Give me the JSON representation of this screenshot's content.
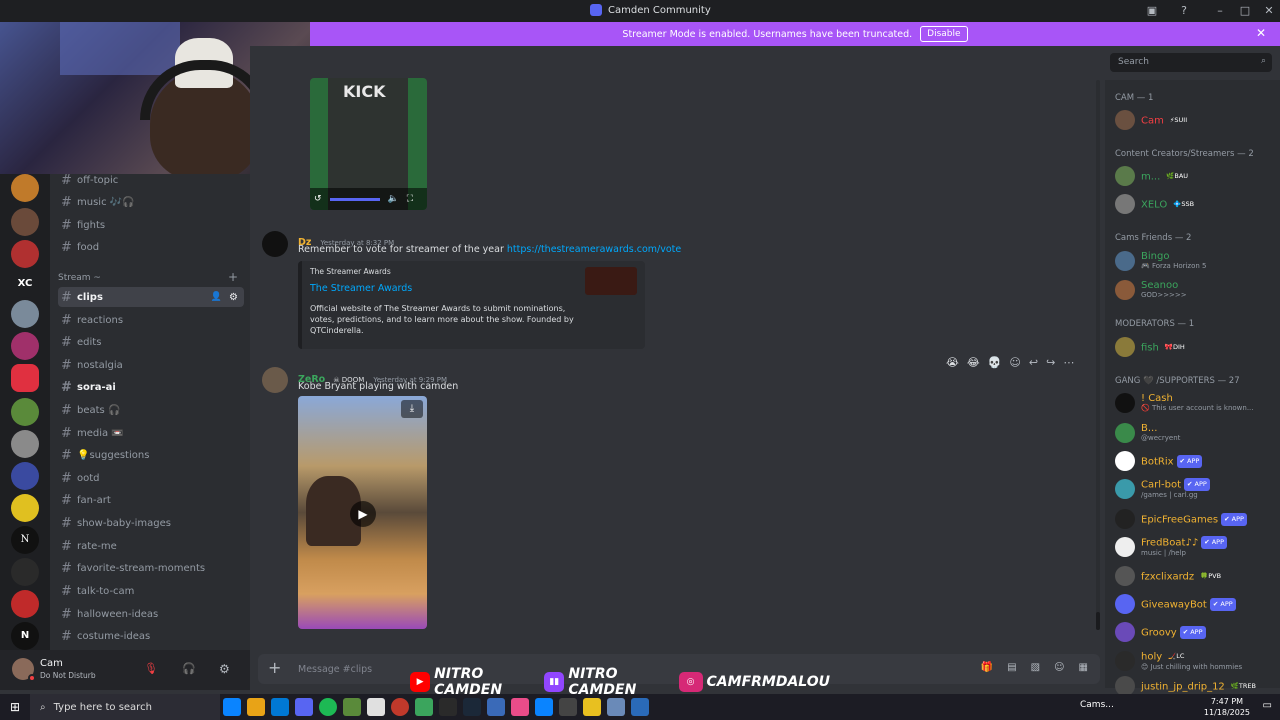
{
  "window": {
    "title": "Camden Community"
  },
  "banner": {
    "text": "Streamer Mode is enabled. Usernames have been truncated.",
    "button": "Disable"
  },
  "header": {
    "search_placeholder": "Search"
  },
  "channels": [
    {
      "label": "off-topic"
    },
    {
      "label": "music 🎶🎧"
    },
    {
      "label": "fights"
    },
    {
      "label": "food"
    }
  ],
  "stream_category": "Stream ~",
  "stream_channels": [
    {
      "label": "clips",
      "active": true
    },
    {
      "label": "reactions"
    },
    {
      "label": "edits"
    },
    {
      "label": "nostalgia"
    },
    {
      "label": "sora-ai"
    },
    {
      "label": "beats 🎧"
    },
    {
      "label": "media 📼"
    },
    {
      "label": "💡suggestions"
    },
    {
      "label": "ootd"
    },
    {
      "label": "fan-art"
    },
    {
      "label": "show-baby-images"
    },
    {
      "label": "rate-me"
    },
    {
      "label": "favorite-stream-moments"
    },
    {
      "label": "talk-to-cam"
    },
    {
      "label": "halloween-ideas"
    },
    {
      "label": "costume-ideas"
    }
  ],
  "user": {
    "name": "Cam",
    "status": "Do Not Disturb"
  },
  "messages": {
    "m1": {
      "author": "Dz",
      "timestamp": "Yesterday at 8:32 PM",
      "text": "Remember to vote for streamer of the year ",
      "link": "https://thestreamerawards.com/vote",
      "embed": {
        "site": "The Streamer Awards",
        "title": "The Streamer Awards",
        "desc": "Official website of The Streamer Awards to submit nominations, votes, predictions, and to learn more about the show. Founded by QTCinderella."
      }
    },
    "m2": {
      "author": "ZeRo",
      "badge": "DOOM",
      "timestamp": "Yesterday at 9:29 PM",
      "text": "Kobe Bryant playing with camden"
    },
    "video_top": {
      "label": "KICK"
    }
  },
  "composer": {
    "placeholder": "Message #clips"
  },
  "members": {
    "sections": [
      {
        "title": "CAM — 1"
      },
      {
        "title": "Content Creators/Streamers — 2"
      },
      {
        "title": "Cams Friends — 2"
      },
      {
        "title": "MODERATORS — 1"
      },
      {
        "title": "GANG 🖤 /SUPPORTERS — 27"
      }
    ],
    "list": [
      {
        "name": "Cam",
        "tag": "⚡SUII",
        "color": "#f23f43"
      },
      {
        "name": "m...",
        "tag": "🌿BAU",
        "color": "#3ba55d"
      },
      {
        "name": "XELO",
        "tag": "💠SSB",
        "color": "#3ba55d"
      },
      {
        "name": "Bingo",
        "sub": "🎮 Forza Horizon 5",
        "color": "#3ba55d"
      },
      {
        "name": "Seanoo",
        "sub": "GOD>>>>>",
        "color": "#3ba55d"
      },
      {
        "name": "fish",
        "tag": "🎀DIH",
        "color": "#3ba55d"
      },
      {
        "name": "! Cash",
        "sub": "🚫 This user account is known...",
        "color": "#f0b232"
      },
      {
        "name": "B...",
        "sub": "@wecryent",
        "color": "#f0b232"
      },
      {
        "name": "BotRix",
        "tag": "✔ APP",
        "color": "#f0b232"
      },
      {
        "name": "Carl-bot",
        "tag": "✔ APP",
        "sub": "/games | carl.gg",
        "color": "#f0b232"
      },
      {
        "name": "EpicFreeGames",
        "tag": "✔ APP",
        "color": "#f0b232"
      },
      {
        "name": "FredBoat♪♪",
        "tag": "✔ APP",
        "sub": "music | /help",
        "color": "#f0b232"
      },
      {
        "name": "fzxclixardz",
        "tag": "🍀PVB",
        "color": "#f0b232"
      },
      {
        "name": "GiveawayBot",
        "tag": "✔ APP",
        "color": "#f0b232"
      },
      {
        "name": "Groovy",
        "tag": "✔ APP",
        "color": "#f0b232"
      },
      {
        "name": "holy",
        "tag": "🏒LC",
        "sub": "😊 Just chilling with hommies",
        "color": "#f0b232"
      },
      {
        "name": "justin_jp_drip_12",
        "tag": "🌿TREB",
        "color": "#f0b232"
      }
    ]
  },
  "socials": [
    {
      "handle": "NITRO CAMDEN",
      "icon": "youtube-icon",
      "color": "#ff0000"
    },
    {
      "handle": "NITRO CAMDEN",
      "icon": "twitch-icon",
      "color": "#9146ff"
    },
    {
      "handle": "CAMFRMDALOU",
      "icon": "instagram-icon",
      "color": "#d62976"
    }
  ],
  "taskbar": {
    "search": "Type here to search",
    "time": "7:47 PM",
    "date": "11/18/2025",
    "app_label": "Cams..."
  }
}
